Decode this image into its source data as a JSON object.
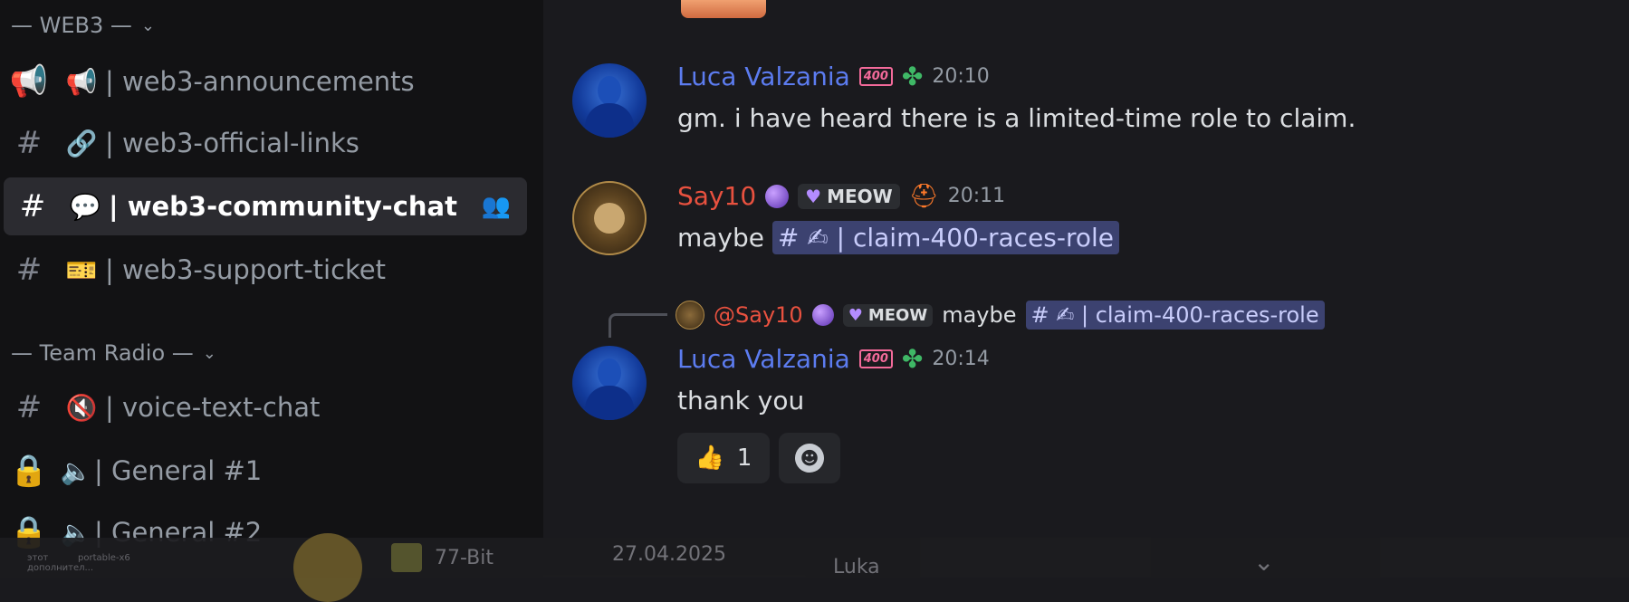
{
  "sidebar": {
    "categories": [
      {
        "label": "— WEB3 —",
        "chevron": "⌄"
      },
      {
        "label": "— Team Radio —",
        "chevron": "⌄"
      }
    ],
    "channels": [
      {
        "icon": "megaphone-icon",
        "emoji": "📢",
        "label": "| web3-announcements"
      },
      {
        "icon": "hash-icon",
        "emoji": "🔗",
        "label": "| web3-official-links"
      },
      {
        "icon": "hash-icon",
        "emoji": "💬",
        "label": "| web3-community-chat",
        "active": true
      },
      {
        "icon": "hash-icon",
        "emoji": "🎫",
        "label": "| web3-support-ticket"
      },
      {
        "icon": "hash-icon",
        "emoji": "🔇",
        "label": "| voice-text-chat"
      },
      {
        "icon": "lock-icon",
        "emoji": "🔈",
        "label": "| General #1"
      },
      {
        "icon": "lock-icon",
        "emoji": "🔈",
        "label": "| General #2"
      }
    ]
  },
  "messages": [
    {
      "author": "Luca Valzania",
      "badge": "400",
      "time": "20:10",
      "text": "gm. i have heard there is a limited-time role to claim."
    },
    {
      "author": "Say10",
      "tag": "MEOW",
      "time": "20:11",
      "text": "maybe",
      "mention": "# ✍ | claim-400-races-role"
    },
    {
      "reply": {
        "author": "@Say10",
        "tag": "MEOW",
        "text": "maybe",
        "mention": "# ✍ | claim-400-races-role"
      },
      "author": "Luca Valzania",
      "badge": "400",
      "time": "20:14",
      "text": "thank you",
      "reactions": [
        {
          "emoji": "👍",
          "count": "1"
        }
      ]
    }
  ],
  "taskbar": {
    "items": [
      "77-Bit",
      "27.04.2025",
      "Luka"
    ],
    "small1": "этот",
    "small2": "portable-x6",
    "small3": "дополнител..."
  },
  "colors": {
    "sidebar_bg": "#121214",
    "main_bg": "#1a1a1e",
    "author_blue": "#5c7cf0",
    "author_red": "#e8513f",
    "mention_bg": "#3c4270"
  }
}
